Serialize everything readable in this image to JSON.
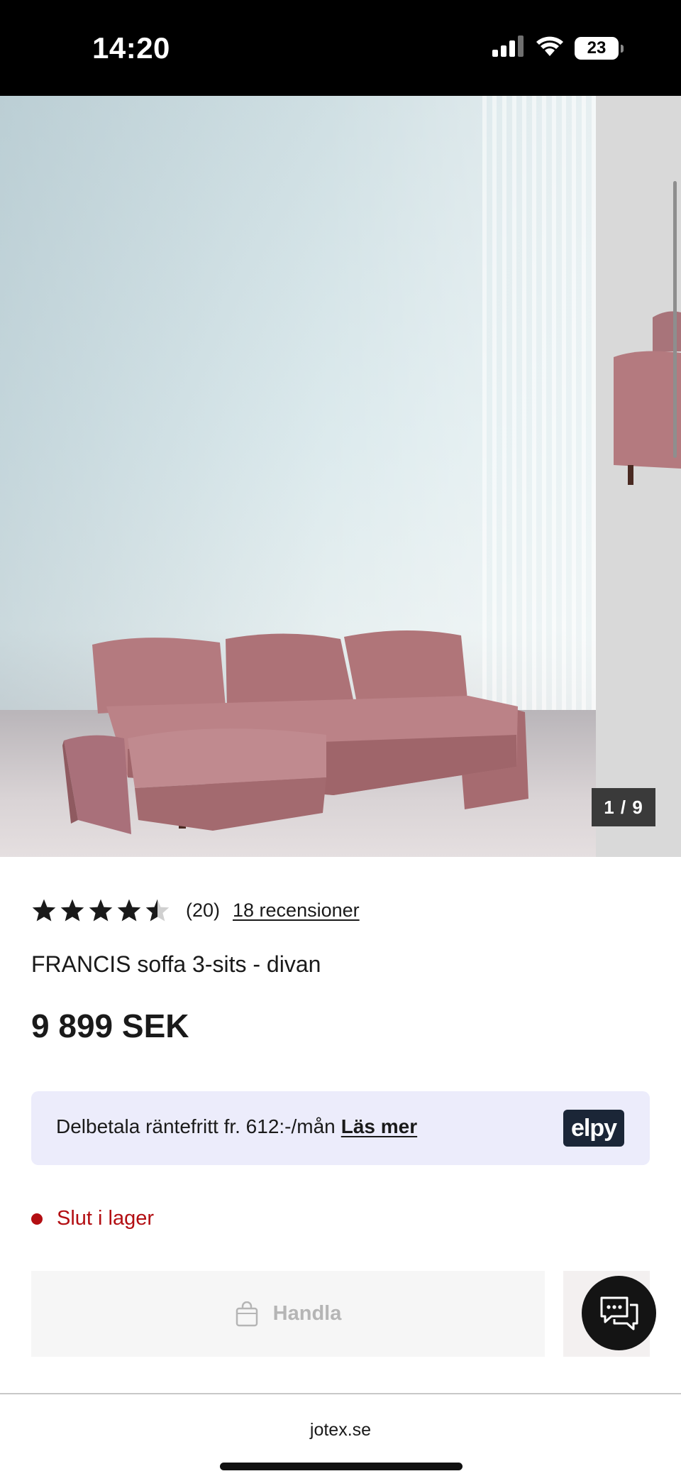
{
  "status_bar": {
    "time": "14:20",
    "battery": "23",
    "icons": [
      "signal-icon",
      "wifi-icon",
      "battery-icon"
    ]
  },
  "gallery": {
    "counter": "1 / 9",
    "image_subject": "pink velvet 3-seat sofa with chaise",
    "sofa_color": "#b47a7f"
  },
  "product": {
    "rating_value": 4.5,
    "rating_count": "(20)",
    "reviews_link": "18 recensioner",
    "title": "FRANCIS soffa 3-sits - divan",
    "price": "9 899 SEK"
  },
  "financing": {
    "text": "Delbetala räntefritt fr. 612:-/mån",
    "link": "Läs mer",
    "provider_logo": "elpy"
  },
  "stock": {
    "status": "Slut i lager",
    "color": "#b30e12"
  },
  "actions": {
    "buy_label": "Handla",
    "buy_icon": "shopping-bag-icon",
    "chat_icon": "chat-bubbles-icon"
  },
  "browser": {
    "url": "jotex.se"
  }
}
